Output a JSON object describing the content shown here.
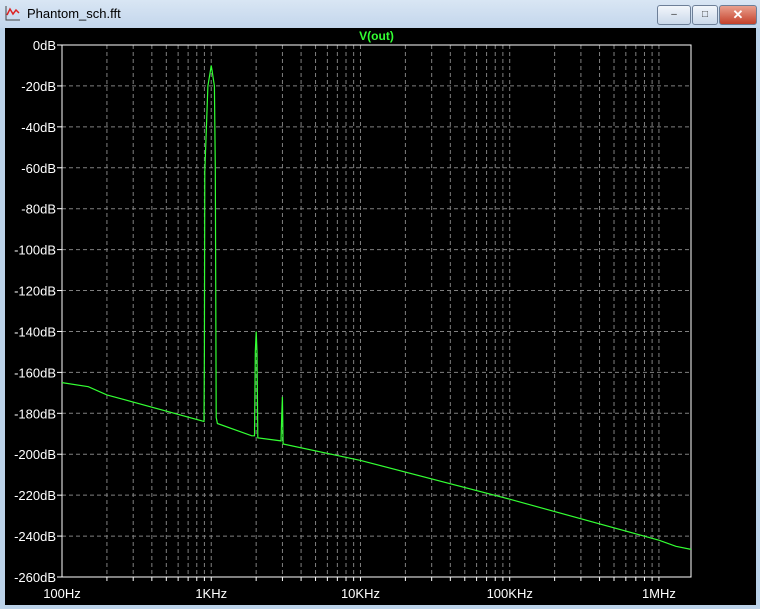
{
  "window": {
    "title": "Phantom_sch.fft",
    "minimize_label": "–",
    "maximize_label": "□",
    "close_label": "✕"
  },
  "colors": {
    "trace": "#33ff33",
    "grid": "#808080",
    "axis": "#ffffff",
    "label": "#ffffff",
    "background": "#000000"
  },
  "chart_data": {
    "type": "line",
    "title": "V(out)",
    "xscale": "log",
    "xlim": [
      100,
      1640000
    ],
    "ylim": [
      -260,
      0
    ],
    "xticks": [
      100,
      1000,
      10000,
      100000,
      1000000
    ],
    "xtick_labels": [
      "100Hz",
      "1KHz",
      "10KHz",
      "100KHz",
      "1MHz"
    ],
    "yticks": [
      0,
      -20,
      -40,
      -60,
      -80,
      -100,
      -120,
      -140,
      -160,
      -180,
      -200,
      -220,
      -240,
      -260
    ],
    "ytick_labels": [
      "0dB",
      "-20dB",
      "-40dB",
      "-60dB",
      "-80dB",
      "-100dB",
      "-120dB",
      "-140dB",
      "-160dB",
      "-180dB",
      "-200dB",
      "-220dB",
      "-240dB",
      "-260dB"
    ],
    "grid": true,
    "series": [
      {
        "name": "V(out)",
        "x": [
          100,
          150,
          200,
          895,
          900,
          905,
          950,
          990,
          1000,
          1010,
          1050,
          1065,
          1080,
          1100,
          1870,
          1950,
          1975,
          2000,
          2025,
          2050,
          2935,
          2970,
          3000,
          3030,
          10000,
          100000,
          1000000,
          1300000,
          1640000
        ],
        "y": [
          -165,
          -167,
          -171,
          -184,
          -150,
          -62,
          -20,
          -12,
          -10,
          -12,
          -20,
          -60,
          -182,
          -185,
          -191,
          -191,
          -150,
          -140,
          -150,
          -192,
          -193.5,
          -180,
          -172,
          -195,
          -203,
          -222,
          -242,
          -245,
          -246.5
        ]
      }
    ]
  }
}
